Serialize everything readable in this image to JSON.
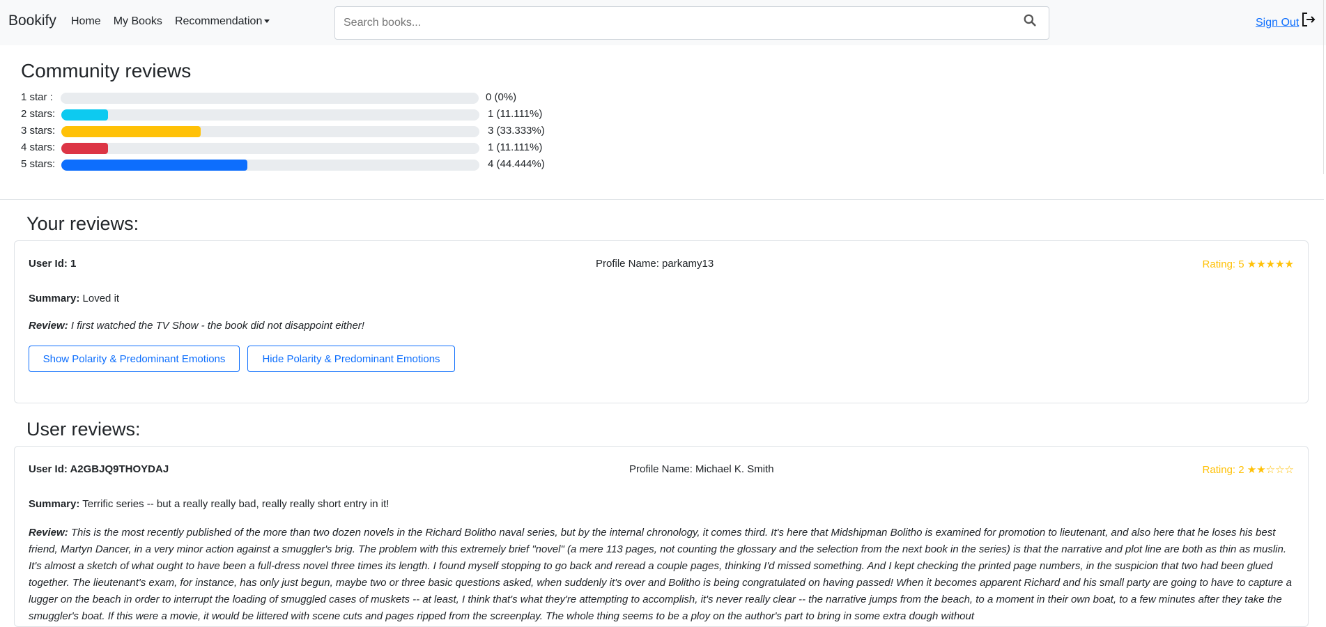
{
  "navbar": {
    "brand": "Bookify",
    "links": [
      "Home",
      "My Books",
      "Recommendation"
    ],
    "search_placeholder": "Search books...",
    "sign_out": "Sign Out"
  },
  "community": {
    "title": "Community reviews",
    "rows": [
      {
        "label": "1 star :",
        "count_text": "0 (0%)",
        "fraction": 0,
        "color": "#0dcaf0"
      },
      {
        "label": "2 stars:",
        "count_text": "1 (11.111%)",
        "fraction": 0.11111,
        "color": "#0dcaf0"
      },
      {
        "label": "3 stars:",
        "count_text": "3 (33.333%)",
        "fraction": 0.33333,
        "color": "#ffc107"
      },
      {
        "label": "4 stars:",
        "count_text": "1 (11.111%)",
        "fraction": 0.11111,
        "color": "#dc3545"
      },
      {
        "label": "5 stars:",
        "count_text": "4 (44.444%)",
        "fraction": 0.44444,
        "color": "#0d6efd"
      }
    ]
  },
  "your_reviews": {
    "title": "Your reviews:",
    "review": {
      "user_id": "User Id: 1",
      "profile_name": "Profile Name: parkamy13",
      "rating": "Rating: 5 ★★★★★",
      "summary_label": "Summary:",
      "summary": "Loved it",
      "review_label": "Review:",
      "review": "I first watched the TV Show - the book did not disappoint either!",
      "show_button": "Show Polarity & Predominant Emotions",
      "hide_button": "Hide Polarity & Predominant Emotions"
    }
  },
  "user_reviews": {
    "title": "User reviews:",
    "review": {
      "user_id": "User Id: A2GBJQ9THOYDAJ",
      "profile_name": "Profile Name: Michael K. Smith",
      "rating": "Rating: 2 ★★☆☆☆",
      "summary_label": "Summary:",
      "summary": "Terrific series -- but a really really bad, really really short entry in it!",
      "review_label": "Review:",
      "review": "This is the most recently published of the more than two dozen novels in the Richard Bolitho naval series, but by the internal chronology, it comes third. It's here that Midshipman Bolitho is examined for promotion to lieutenant, and also here that he loses his best friend, Martyn Dancer, in a very minor action against a smuggler's brig. The problem with this extremely brief \"novel\" (a mere 113 pages, not counting the glossary and the selection from the next book in the series) is that the narrative and plot line are both as thin as muslin. It's almost a sketch of what ought to have been a full-dress novel three times its length. I found myself stopping to go back and reread a couple pages, thinking I'd missed something. And I kept checking the printed page numbers, in the suspicion that two had been glued together. The lieutenant's exam, for instance, has only just begun, maybe two or three basic questions asked, when suddenly it's over and Bolitho is being congratulated on having passed! When it becomes apparent Richard and his small party are going to have to capture a lugger on the beach in order to interrupt the loading of smuggled cases of muskets -- at least, I think that's what they're attempting to accomplish, it's never really clear -- the narrative jumps from the beach, to a moment in their own boat, to a few minutes after they take the smuggler's boat. If this were a movie, it would be littered with scene cuts and pages ripped from the screenplay. The whole thing seems to be a ploy on the author's part to bring in some extra dough without"
    }
  }
}
